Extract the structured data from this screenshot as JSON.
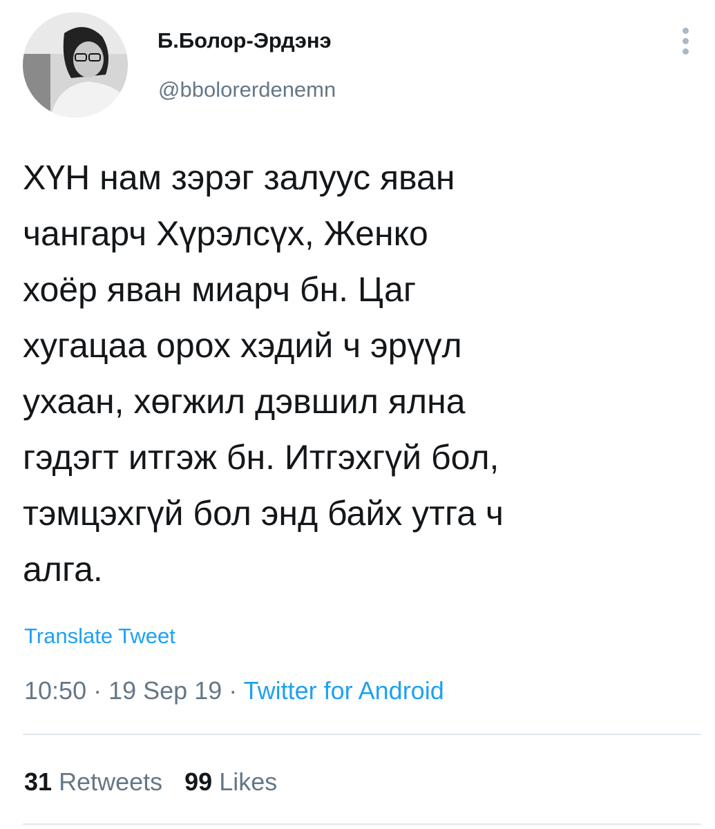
{
  "user": {
    "display_name": "Б.Болор-Эрдэнэ",
    "handle": "@bbolorerdenemn",
    "avatar_icon": "profile-photo"
  },
  "tweet": {
    "text": "ХҮН нам зэрэг залуус яван\nчангарч Хүрэлсүх, Женко\nхоёр яван миарч бн. Цаг\nхугацаа орох хэдий ч эрүүл\nухаан, хөгжил дэвшил ялна\nгэдэгт итгэж бн. Итгэхгүй бол,\nтэмцэхгүй бол энд байх утга ч\nалга.",
    "translate_label": "Translate Tweet",
    "time": "10:50",
    "date": "19 Sep 19",
    "separator": " · ",
    "source": "Twitter for Android"
  },
  "stats": {
    "retweets_count": "31",
    "retweets_label": "Retweets",
    "likes_count": "99",
    "likes_label": "Likes"
  },
  "colors": {
    "link": "#1da1f2",
    "secondary_text": "#657786",
    "primary_text": "#14171a",
    "divider": "#e1e8ed"
  }
}
